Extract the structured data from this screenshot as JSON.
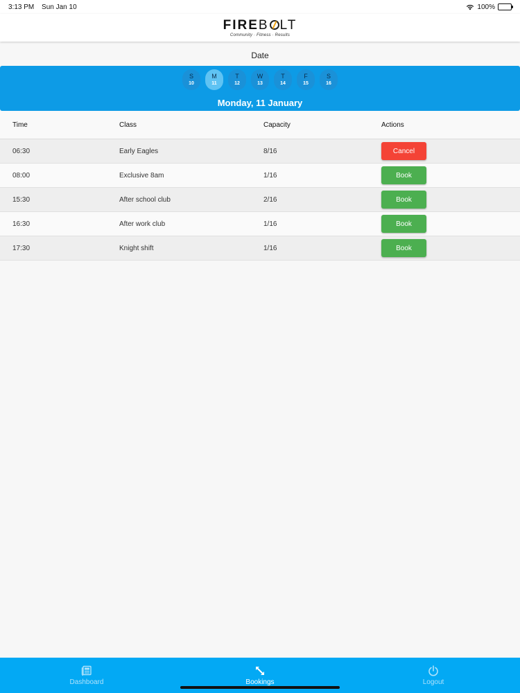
{
  "status_bar": {
    "time": "3:13 PM",
    "date": "Sun Jan 10",
    "battery": "100%"
  },
  "brand": {
    "name_bold": "FIRE",
    "name_b": "B",
    "name_light": "LT",
    "tagline": "Community · Fitness · Results"
  },
  "date_section": {
    "label": "Date",
    "days": [
      {
        "letter": "S",
        "num": "10"
      },
      {
        "letter": "M",
        "num": "11"
      },
      {
        "letter": "T",
        "num": "12"
      },
      {
        "letter": "W",
        "num": "13"
      },
      {
        "letter": "T",
        "num": "14"
      },
      {
        "letter": "F",
        "num": "15"
      },
      {
        "letter": "S",
        "num": "16"
      }
    ],
    "selected_index": 1,
    "selected_date": "Monday, 11 January"
  },
  "table": {
    "headers": {
      "time": "Time",
      "class": "Class",
      "capacity": "Capacity",
      "actions": "Actions"
    },
    "rows": [
      {
        "time": "06:30",
        "class": "Early Eagles",
        "capacity": "8/16",
        "action": "Cancel"
      },
      {
        "time": "08:00",
        "class": "Exclusive 8am",
        "capacity": "1/16",
        "action": "Book"
      },
      {
        "time": "15:30",
        "class": "After school club",
        "capacity": "2/16",
        "action": "Book"
      },
      {
        "time": "16:30",
        "class": "After work club",
        "capacity": "1/16",
        "action": "Book"
      },
      {
        "time": "17:30",
        "class": "Knight shift",
        "capacity": "1/16",
        "action": "Book"
      }
    ]
  },
  "tabs": [
    {
      "label": "Dashboard",
      "icon": "newspaper-icon"
    },
    {
      "label": "Bookings",
      "icon": "expand-arrows-icon"
    },
    {
      "label": "Logout",
      "icon": "power-icon"
    }
  ],
  "colors": {
    "week_bar": "#0d9be6",
    "tab_bar": "#03a9f4",
    "book": "#4caf50",
    "cancel": "#f44336"
  }
}
